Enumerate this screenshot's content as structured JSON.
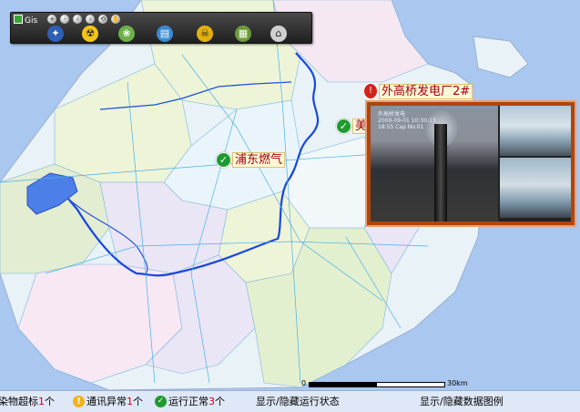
{
  "toolbar": {
    "title": "Gis",
    "small_tools": [
      "+",
      "-",
      "‹",
      "›",
      "⟲",
      "✋"
    ],
    "big_tools": [
      {
        "icon": "compass-icon",
        "glyph": "✦",
        "color": "#2e5fb7"
      },
      {
        "icon": "radiation-icon",
        "glyph": "☢",
        "color": "#f2c417"
      },
      {
        "icon": "pollution-icon",
        "glyph": "❀",
        "color": "#6bb04a"
      },
      {
        "icon": "database-icon",
        "glyph": "▤",
        "color": "#3b8ad2"
      },
      {
        "icon": "hazard-icon",
        "glyph": "☠",
        "color": "#e3b10e"
      },
      {
        "icon": "building-icon",
        "glyph": "▦",
        "color": "#6c9b3a"
      },
      {
        "icon": "factory-icon",
        "glyph": "⌂",
        "color": "#d0d0d0"
      }
    ]
  },
  "markers": [
    {
      "name": "浦东燃气",
      "status": "ok"
    },
    {
      "name": "美",
      "status": "ok"
    },
    {
      "name": "外高桥发电厂2#",
      "status": "alarm"
    }
  ],
  "video": {
    "overlay_lines": [
      "外高桥发电",
      "2009-09-01 10:30:13",
      "18:55 Cap No.01"
    ]
  },
  "scale": {
    "start": "0",
    "end": "30km"
  },
  "status_bar": {
    "exceed": {
      "label": "染物超标",
      "count": "1",
      "unit": "个"
    },
    "comm": {
      "label": "通讯异常",
      "count": "1",
      "unit": "个"
    },
    "normal": {
      "label": "运行正常",
      "count": "3",
      "unit": "个"
    },
    "toggle_status": "显示/隐藏运行状态",
    "toggle_legend": "显示/隐藏数据图例"
  }
}
